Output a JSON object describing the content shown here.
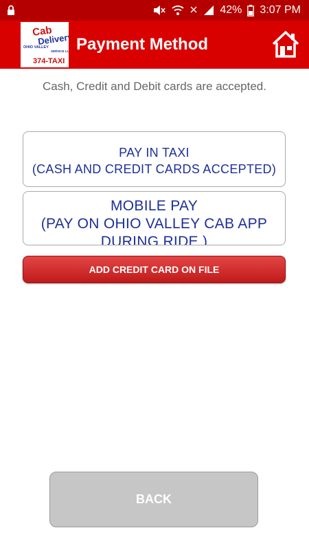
{
  "status_bar": {
    "battery_percent": "42%",
    "time": "3:07 PM",
    "icons": [
      "lock-icon",
      "mute-icon",
      "wifi-icon",
      "no-signal-icon",
      "signal-icon",
      "battery-icon"
    ]
  },
  "app_bar": {
    "title": "Payment Method",
    "logo": {
      "line1": "Cab",
      "line2": "Delivery",
      "line3": "OHIO VALLEY",
      "line4": "SERVICE LLC",
      "line5": "374-TAXI"
    },
    "home_icon": "house-icon"
  },
  "main": {
    "subtitle": "Cash, Credit and Debit cards are accepted.",
    "options": [
      {
        "line1": "PAY IN TAXI",
        "line2": "(CASH AND CREDIT CARDS ACCEPTED)"
      },
      {
        "line1": "MOBILE PAY",
        "line2": "(PAY ON OHIO VALLEY CAB APP",
        "line3": "DURING RIDE )"
      }
    ],
    "add_card_label": "ADD CREDIT CARD ON FILE",
    "back_label": "BACK"
  },
  "colors": {
    "status_bar": "#b50000",
    "app_bar": "#d90000",
    "option_text": "#1d2f99",
    "add_card_button": "#d03030",
    "back_button": "#c6c6c6"
  }
}
